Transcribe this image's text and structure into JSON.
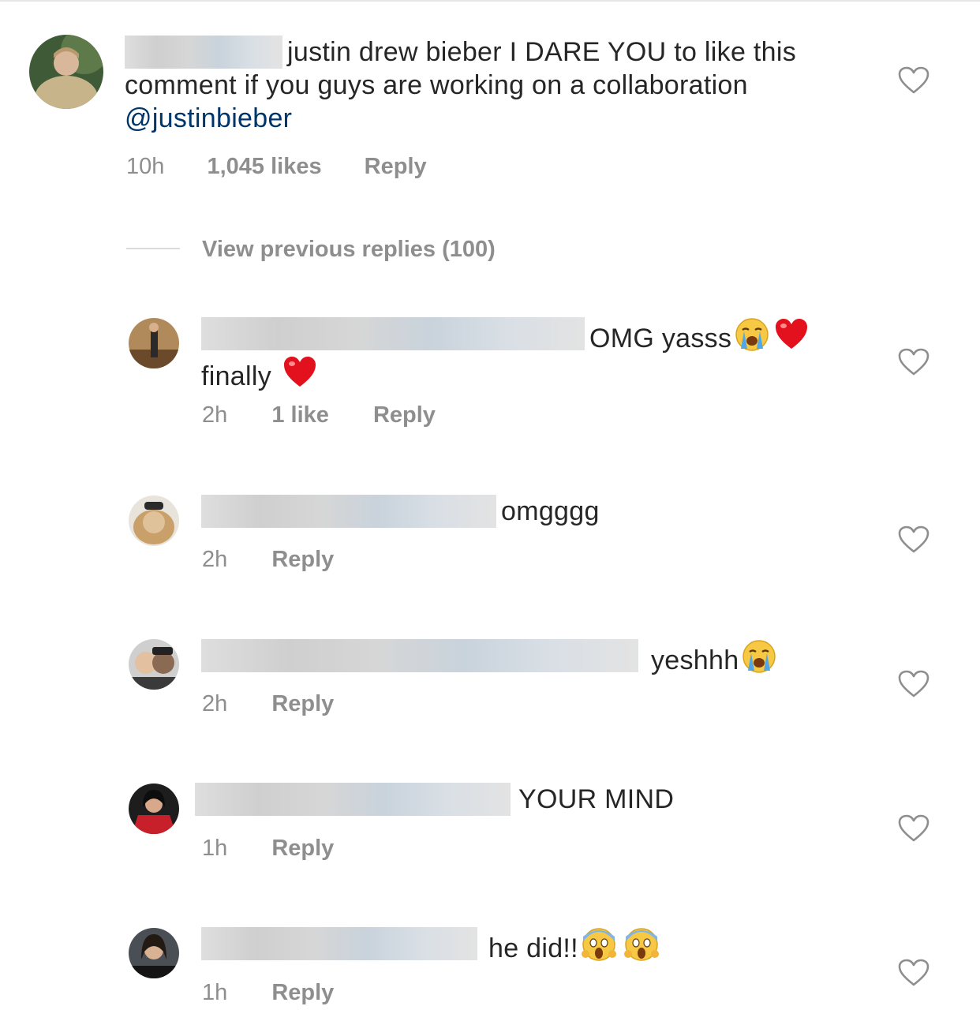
{
  "main_comment": {
    "text": "justin drew bieber I DARE YOU to like this comment if you guys are working on a collaboration",
    "mention": "@justinbieber",
    "time": "10h",
    "likes": "1,045 likes",
    "reply_label": "Reply"
  },
  "view_previous_label": "View previous replies (100)",
  "replies": [
    {
      "text": "OMG yasss",
      "line2": "finally",
      "time": "2h",
      "likes": "1 like",
      "reply_label": "Reply"
    },
    {
      "text": "omgggg",
      "time": "2h",
      "reply_label": "Reply"
    },
    {
      "text": "yeshhh",
      "time": "2h",
      "reply_label": "Reply"
    },
    {
      "text": "YOUR MIND",
      "time": "1h",
      "reply_label": "Reply"
    },
    {
      "text": "he did!!",
      "time": "1h",
      "reply_label": "Reply"
    }
  ],
  "icons": {
    "like": "heart-outline-icon",
    "red_heart": "red-heart-emoji",
    "crying": "loudly-crying-face-emoji",
    "scream": "face-screaming-in-fear-emoji"
  },
  "colors": {
    "text": "#262626",
    "meta": "#8e8e8e",
    "mention": "#003569",
    "heart_stroke": "#8e8e8e"
  }
}
